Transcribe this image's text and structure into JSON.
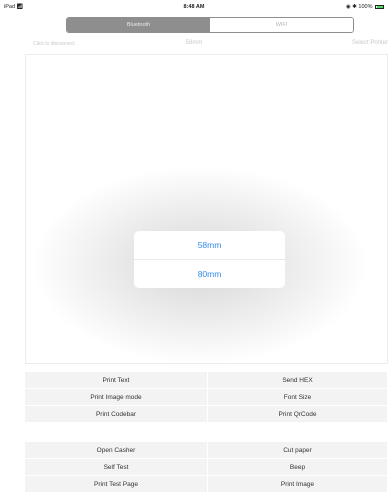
{
  "status_bar": {
    "device": "iPad",
    "time": "8:48 AM",
    "battery": "100%"
  },
  "segmented": {
    "bluetooth": "Bluetooth",
    "wifi": "WIFI"
  },
  "info_row": {
    "connection": "Click to disconnect",
    "paper": "58mm",
    "select": "Select Printer"
  },
  "popup": {
    "options": [
      "58mm",
      "80mm"
    ]
  },
  "buttons_group1": [
    "Print Text",
    "Send HEX",
    "Print Image mode",
    "Font Size",
    "Print Codebar",
    "Print QrCode"
  ],
  "buttons_group2": [
    "Open Casher",
    "Cut paper",
    "Self Test",
    "Beep",
    "Print Test Page",
    "Print Image"
  ],
  "colors": {
    "accent": "#2f8ae6",
    "segment_active": "#8e8e8e",
    "button_bg": "#f3f3f3"
  }
}
